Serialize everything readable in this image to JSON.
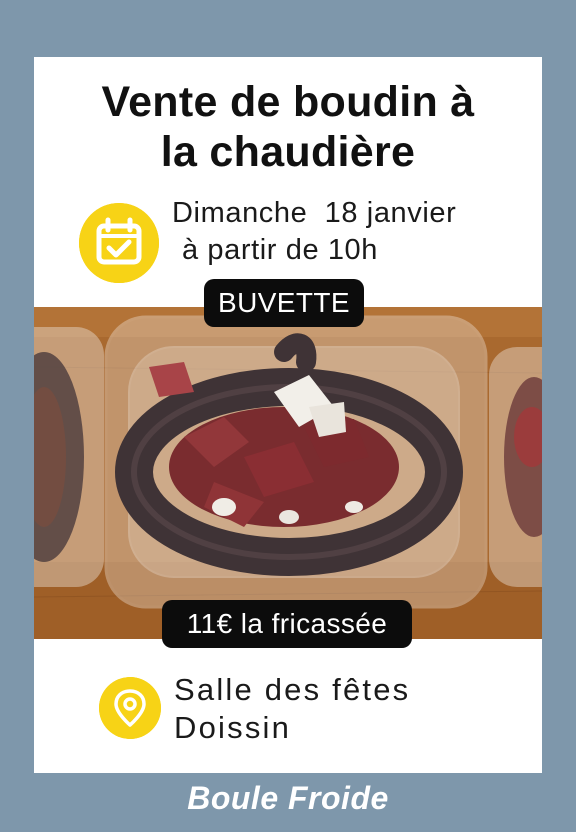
{
  "poster": {
    "title_lines": [
      "Vente de boudin à",
      "la chaudière"
    ],
    "date_lines": [
      "Dimanche  18 janvier",
      "à partir de 10h"
    ],
    "buvette_label": "BUVETTE",
    "price_label": "11€ la fricassée",
    "location_lines": [
      "Salle des fêtes",
      "Doissin"
    ],
    "icons": {
      "date": "calendar-check-icon",
      "location": "map-pin-icon"
    }
  },
  "footer": {
    "brand": "Boule Froide"
  },
  "colors": {
    "background": "#7e97ab",
    "accent_yellow": "#f7d316",
    "pill_black": "#0c0c0c",
    "card_white": "#ffffff"
  }
}
